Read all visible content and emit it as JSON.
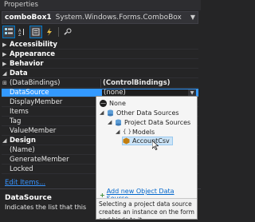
{
  "window": {
    "title": "Properties"
  },
  "object_selector": {
    "name": "comboBox1",
    "type": "System.Windows.Forms.ComboBox"
  },
  "toolbar": {
    "buttons": [
      "categorized-icon",
      "alphabetical-icon",
      "properties-icon",
      "events-icon",
      "property-pages-icon"
    ]
  },
  "grid": {
    "categories": {
      "accessibility": "Accessibility",
      "appearance": "Appearance",
      "behavior": "Behavior",
      "data": "Data",
      "design": "Design"
    },
    "data_rows": {
      "databindings": {
        "name": "(DataBindings)",
        "value": "(ControlBindings)"
      },
      "datasource": {
        "name": "DataSource",
        "value": "(none)"
      },
      "displaymember": {
        "name": "DisplayMember"
      },
      "items": {
        "name": "Items"
      },
      "tag": {
        "name": "Tag"
      },
      "valuemember": {
        "name": "ValueMember"
      }
    },
    "design_rows": {
      "name": {
        "name": "(Name)"
      },
      "generatemember": {
        "name": "GenerateMember"
      },
      "locked": {
        "name": "Locked"
      }
    }
  },
  "commands": {
    "edit_items": "Edit Items..."
  },
  "description": {
    "title": "DataSource",
    "text": "Indicates the list that this"
  },
  "popup": {
    "tree": {
      "none": "None",
      "other": "Other Data Sources",
      "project": "Project Data Sources",
      "models": "Models",
      "account": "AccountCsv"
    },
    "add_link": "Add new Object Data Source...",
    "description": "Selecting a project data source creates an instance on the form and binds to it."
  },
  "colors": {
    "background": "#252526",
    "selection": "#3399ff",
    "link": "#3794ff",
    "popup_bg": "#f5f5f5"
  }
}
